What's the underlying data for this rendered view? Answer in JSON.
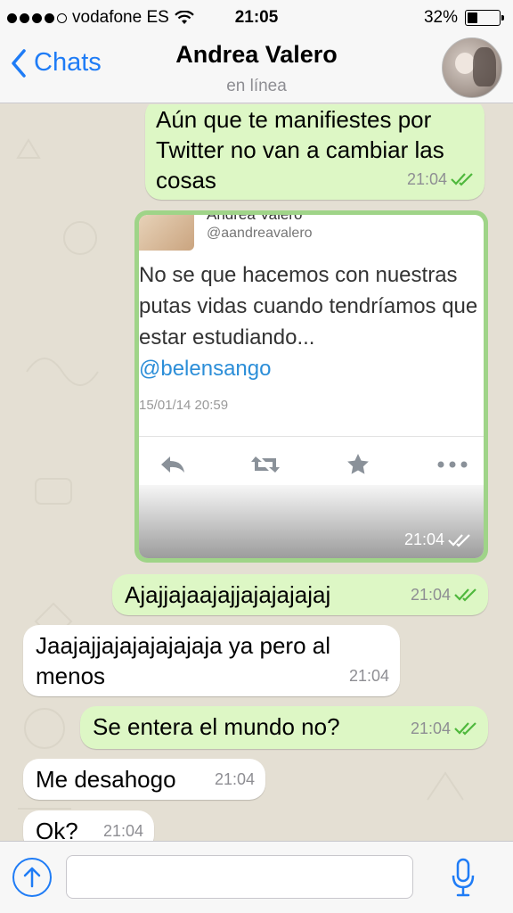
{
  "status_bar": {
    "carrier": "vodafone ES",
    "time": "21:05",
    "battery_text": "32%",
    "battery_level": 0.32,
    "signal_icon": "signal-dots-icon",
    "wifi_icon": "wifi-icon"
  },
  "nav": {
    "back_label": "Chats",
    "title": "Andrea Valero",
    "subtitle": "en línea"
  },
  "messages": [
    {
      "dir": "out",
      "text": "Aún que te manifiestes por Twitter no van a cambiar las cosas",
      "time": "21:04",
      "status": "read"
    },
    {
      "dir": "out",
      "type": "image",
      "time": "21:04",
      "status": "read"
    },
    {
      "dir": "out",
      "text": "Ajajjajaajajjajajajajaj",
      "time": "21:04",
      "status": "read"
    },
    {
      "dir": "in",
      "text": "Jaajajjajajajajajaja ya pero al menos",
      "time": "21:04"
    },
    {
      "dir": "out",
      "text": "Se entera el mundo no?",
      "time": "21:04",
      "status": "read"
    },
    {
      "dir": "in",
      "text": "Me desahogo",
      "time": "21:04"
    },
    {
      "dir": "in",
      "text": "Ok?",
      "time": "21:04"
    }
  ],
  "tweet": {
    "name": "Andrea Valero",
    "handle": "@aandreavalero",
    "text": "No se que hacemos con nuestras putas vidas cuando tendríamos que estar estudiando...",
    "mention": "@belensango",
    "date": "15/01/14 20:59",
    "actions": [
      "reply-icon",
      "retweet-icon",
      "favorite-icon",
      "more-icon"
    ]
  },
  "input": {
    "placeholder": "",
    "attach_icon": "share-arrow-icon",
    "mic_icon": "microphone-icon"
  },
  "colors": {
    "accent": "#1f7cf6",
    "outgoing_bubble": "#ddf7c5",
    "incoming_bubble": "#ffffff",
    "read_ticks": "#4fb83d"
  }
}
